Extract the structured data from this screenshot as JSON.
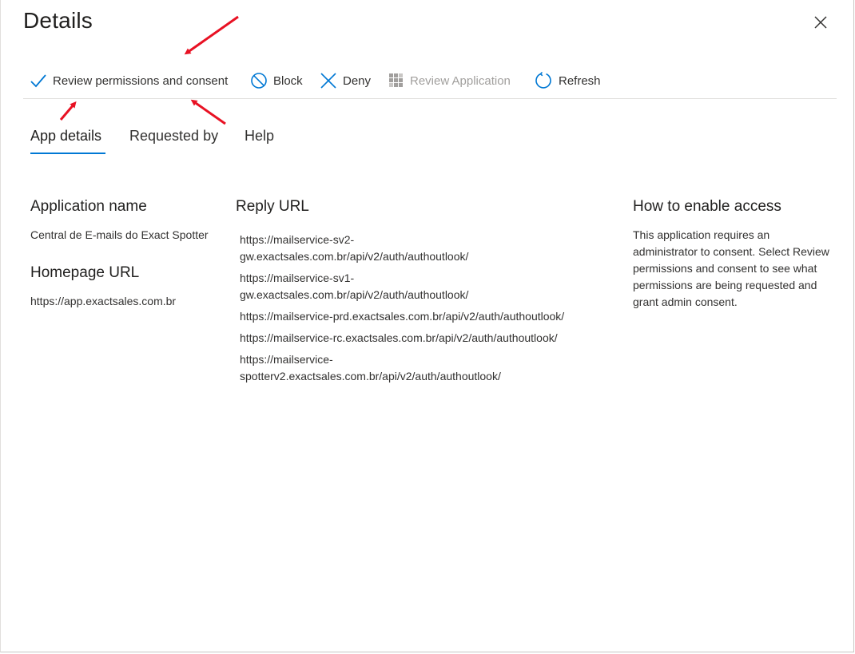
{
  "header": {
    "title": "Details"
  },
  "toolbar": {
    "review_permissions_label": "Review permissions and consent",
    "block_label": "Block",
    "deny_label": "Deny",
    "review_application_label": "Review Application",
    "refresh_label": "Refresh"
  },
  "tabs": [
    {
      "label": "App details"
    },
    {
      "label": "Requested by"
    },
    {
      "label": "Help"
    }
  ],
  "app_details": {
    "application_name_heading": "Application name",
    "application_name": "Central de E-mails do Exact Spotter",
    "homepage_url_heading": "Homepage URL",
    "homepage_url": "https://app.exactsales.com.br",
    "reply_url_heading": "Reply URL",
    "reply_urls": [
      "https://mailservice-sv2-gw.exactsales.com.br/api/v2/auth/authoutlook/",
      "https://mailservice-sv1-gw.exactsales.com.br/api/v2/auth/authoutlook/",
      "https://mailservice-prd.exactsales.com.br/api/v2/auth/authoutlook/",
      "https://mailservice-rc.exactsales.com.br/api/v2/auth/authoutlook/",
      "https://mailservice-spotterv2.exactsales.com.br/api/v2/auth/authoutlook/"
    ],
    "how_to_heading": "How to enable access",
    "how_to_text": "This application requires an administrator to consent. Select Review permissions and consent to see what permissions are being requested and grant admin consent."
  },
  "colors": {
    "accent": "#0078d4",
    "annotation_arrow": "#e81123",
    "disabled_text": "#a19f9d"
  },
  "icons": {
    "close": "close-icon",
    "review_permissions": "checkmark-icon",
    "block": "block-icon",
    "deny": "cross-icon",
    "review_application": "grid-icon",
    "refresh": "refresh-icon"
  }
}
